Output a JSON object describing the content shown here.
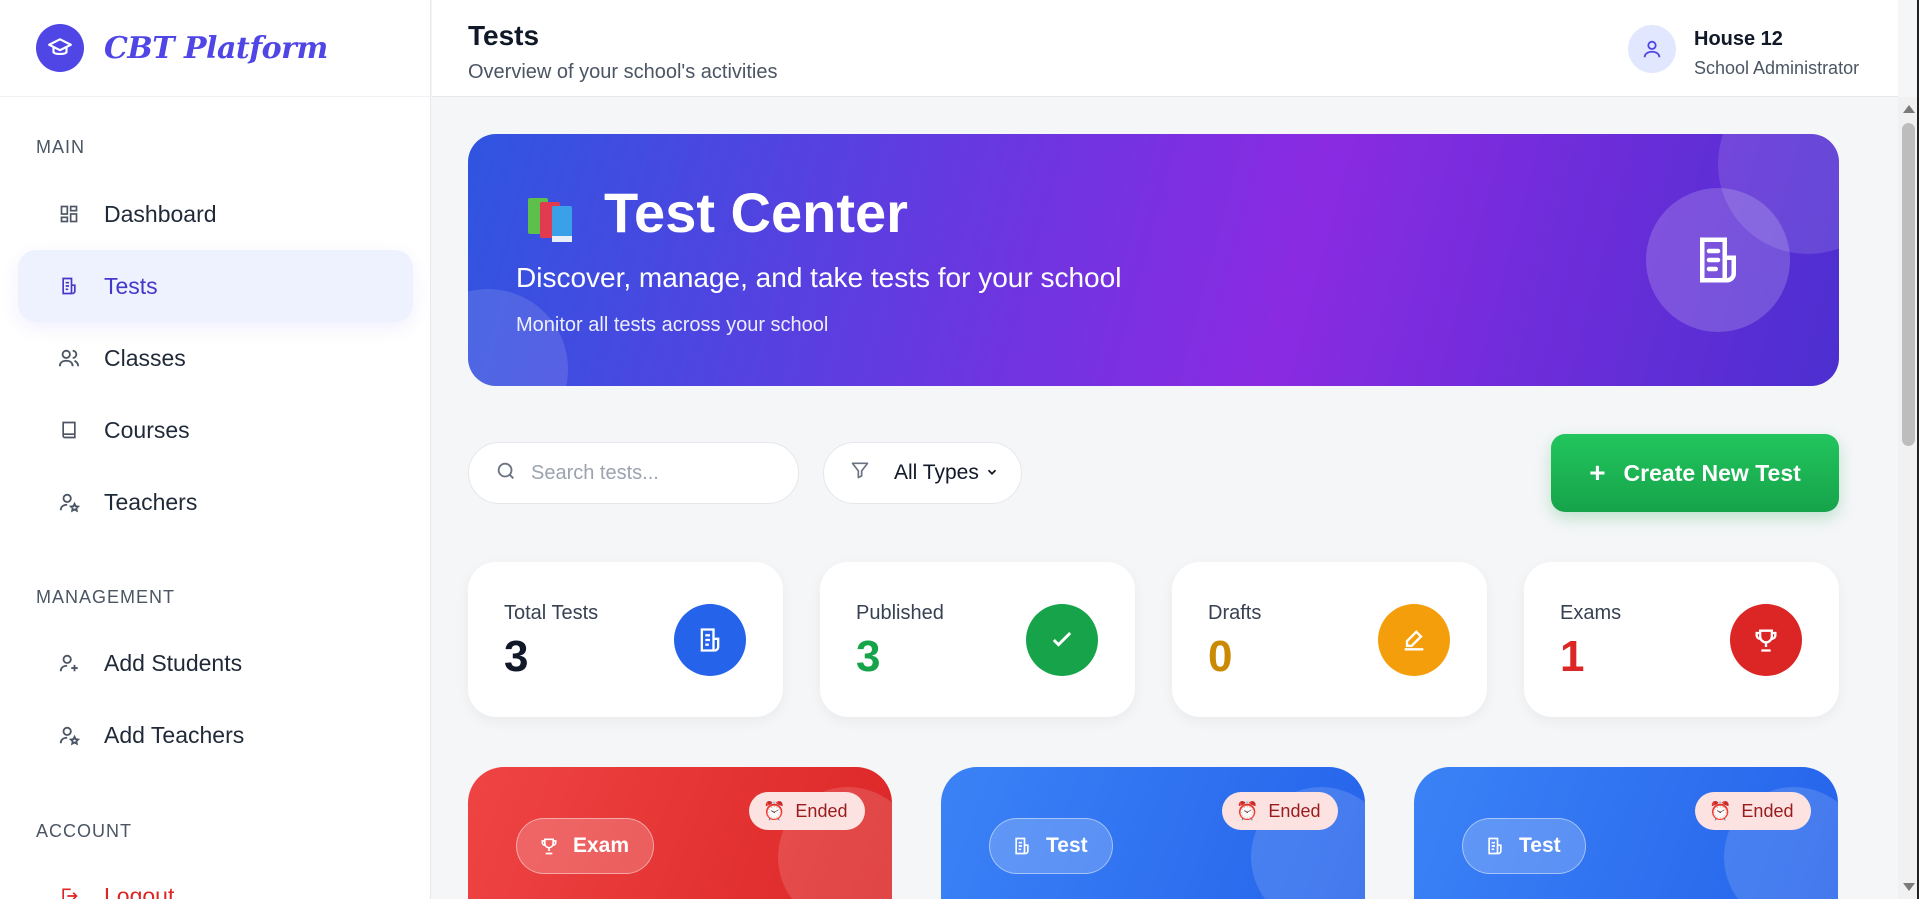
{
  "brand": {
    "name": "CBT Platform"
  },
  "sidebar": {
    "sections": [
      {
        "title": "MAIN",
        "items": [
          {
            "label": "Dashboard",
            "icon": "grid-icon"
          },
          {
            "label": "Tests",
            "icon": "document-icon",
            "active": true
          },
          {
            "label": "Classes",
            "icon": "users-icon"
          },
          {
            "label": "Courses",
            "icon": "book-icon"
          },
          {
            "label": "Teachers",
            "icon": "teacher-icon"
          }
        ]
      },
      {
        "title": "MANAGEMENT",
        "items": [
          {
            "label": "Add Students",
            "icon": "user-plus-icon"
          },
          {
            "label": "Add Teachers",
            "icon": "teacher-icon"
          }
        ]
      },
      {
        "title": "ACCOUNT",
        "items": [
          {
            "label": "Logout",
            "icon": "logout-icon"
          }
        ]
      }
    ]
  },
  "header": {
    "title": "Tests",
    "subtitle": "Overview of your school's activities",
    "user": {
      "name": "House 12",
      "role": "School Administrator"
    }
  },
  "hero": {
    "title": "Test Center",
    "subtitle": "Discover, manage, and take tests for your school",
    "note": "Monitor all tests across your school"
  },
  "toolbar": {
    "search_placeholder": "Search tests...",
    "filter_label": "All Types",
    "create_label": "Create New Test"
  },
  "stats": [
    {
      "label": "Total Tests",
      "value": "3",
      "color": "#111827",
      "icon_bg": "#2563eb",
      "icon": "document-icon"
    },
    {
      "label": "Published",
      "value": "3",
      "color": "#16a34a",
      "icon_bg": "#16a34a",
      "icon": "check-icon"
    },
    {
      "label": "Drafts",
      "value": "0",
      "color": "#ca8a04",
      "icon_bg": "#f59e0b",
      "icon": "edit-icon"
    },
    {
      "label": "Exams",
      "value": "1",
      "color": "#dc2626",
      "icon_bg": "#dc2626",
      "icon": "trophy-icon"
    }
  ],
  "test_cards": [
    {
      "type": "Exam",
      "status": "Ended",
      "color": "#ef4444"
    },
    {
      "type": "Test",
      "status": "Ended",
      "color": "#2563eb"
    },
    {
      "type": "Test",
      "status": "Ended",
      "color": "#2563eb"
    }
  ]
}
